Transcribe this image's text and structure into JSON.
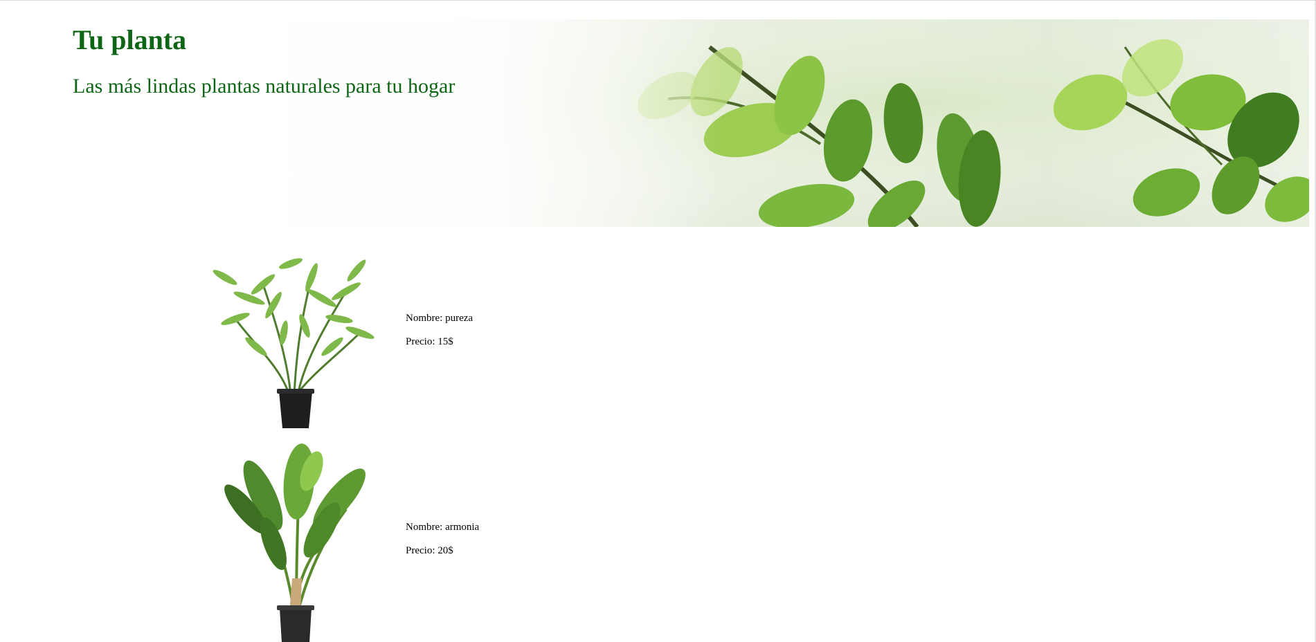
{
  "header": {
    "title": "Tu planta",
    "subtitle": "Las más lindas plantas naturales para tu hogar"
  },
  "products": [
    {
      "name_line": "Nombre: pureza",
      "price_line": "Precio: 15$",
      "image": "bamboo-plant-icon"
    },
    {
      "name_line": "Nombre: armonia",
      "price_line": "Precio: 20$",
      "image": "banana-leaf-plant-icon"
    }
  ],
  "colors": {
    "title_green": "#0d6615",
    "leaf_light": "#a8d45a",
    "leaf_dark": "#3f7d20",
    "pot": "#1e1e1e"
  }
}
